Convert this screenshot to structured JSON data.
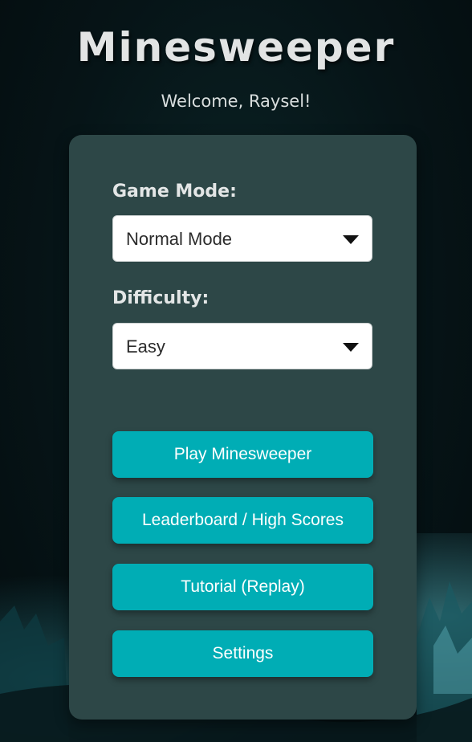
{
  "app": {
    "title": "Minesweeper",
    "welcome": "Welcome, Raysel!"
  },
  "form": {
    "game_mode": {
      "label": "Game Mode:",
      "selected": "Normal Mode"
    },
    "difficulty": {
      "label": "Difficulty:",
      "selected": "Easy"
    }
  },
  "buttons": {
    "play": "Play Minesweeper",
    "leaderboard": "Leaderboard / High Scores",
    "tutorial": "Tutorial (Replay)",
    "settings": "Settings"
  },
  "icons": {
    "select_caret": "caret-down-icon"
  },
  "colors": {
    "accent": "#00adb5",
    "panel": "#2d4747",
    "background": "#061417"
  }
}
